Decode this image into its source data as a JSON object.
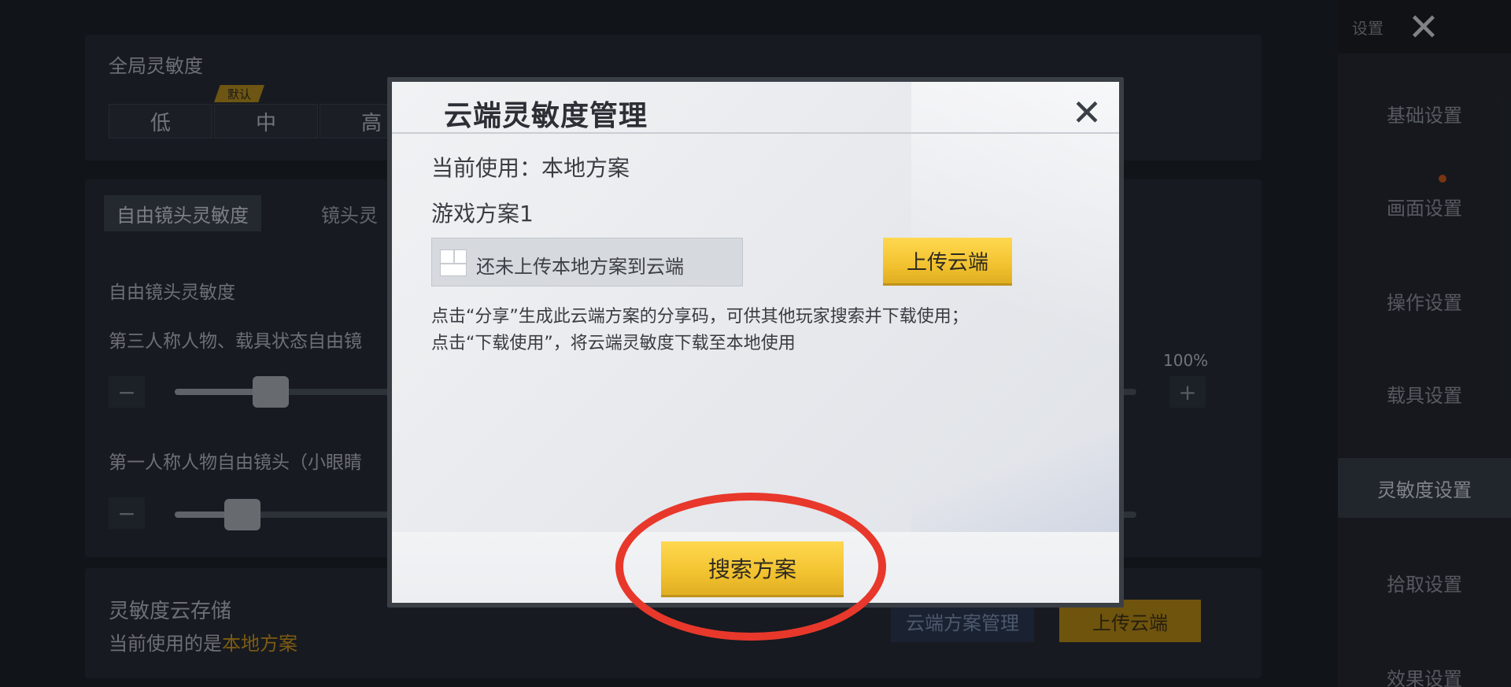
{
  "background": {
    "global_sensitivity": {
      "title": "全局灵敏度",
      "default_badge": "默认",
      "options": [
        "低",
        "中",
        "高"
      ]
    },
    "tabs": [
      "自由镜头灵敏度",
      "镜头灵"
    ],
    "free_camera": {
      "title": "自由镜头灵敏度",
      "third_person_label": "第三人称人物、载具状态自由镜",
      "first_person_label": "第一人称人物自由镜头（小眼睛",
      "minus_icon": "minus",
      "plus_icon": "plus",
      "percent_label": "100%",
      "slider_levels": [
        0.1,
        0.07
      ]
    },
    "cloud_storage": {
      "title": "灵敏度云存储",
      "current_prefix": "当前使用的是",
      "current_value": "本地方案",
      "manage_button": "云端方案管理",
      "upload_button": "上传云端"
    },
    "sidebar": {
      "caption": "设置",
      "close_icon": "close",
      "items": [
        {
          "label": "基础设置",
          "active": false
        },
        {
          "label": "画面设置",
          "active": false
        },
        {
          "label": "操作设置",
          "active": false
        },
        {
          "label": "载具设置",
          "active": false
        },
        {
          "label": "灵敏度设置",
          "active": true
        },
        {
          "label": "拾取设置",
          "active": false
        },
        {
          "label": "效果设置",
          "active": false
        }
      ]
    }
  },
  "modal": {
    "title": "云端灵敏度管理",
    "close_icon": "close",
    "current_use": "当前使用：本地方案",
    "plan_name": "游戏方案1",
    "status_text": "还未上传本地方案到云端",
    "upload_button": "上传云端",
    "description": [
      "点击“分享”生成此云端方案的分享码，可供其他玩家搜索并下载使用；",
      "点击“下载使用”，将云端灵敏度下载至本地使用"
    ],
    "search_button": "搜索方案"
  },
  "colors": {
    "accent_gold": "#f2c230",
    "highlight_ring": "#e8382b",
    "background": "#1c2129",
    "cloud_value_text": "#c9941d"
  }
}
